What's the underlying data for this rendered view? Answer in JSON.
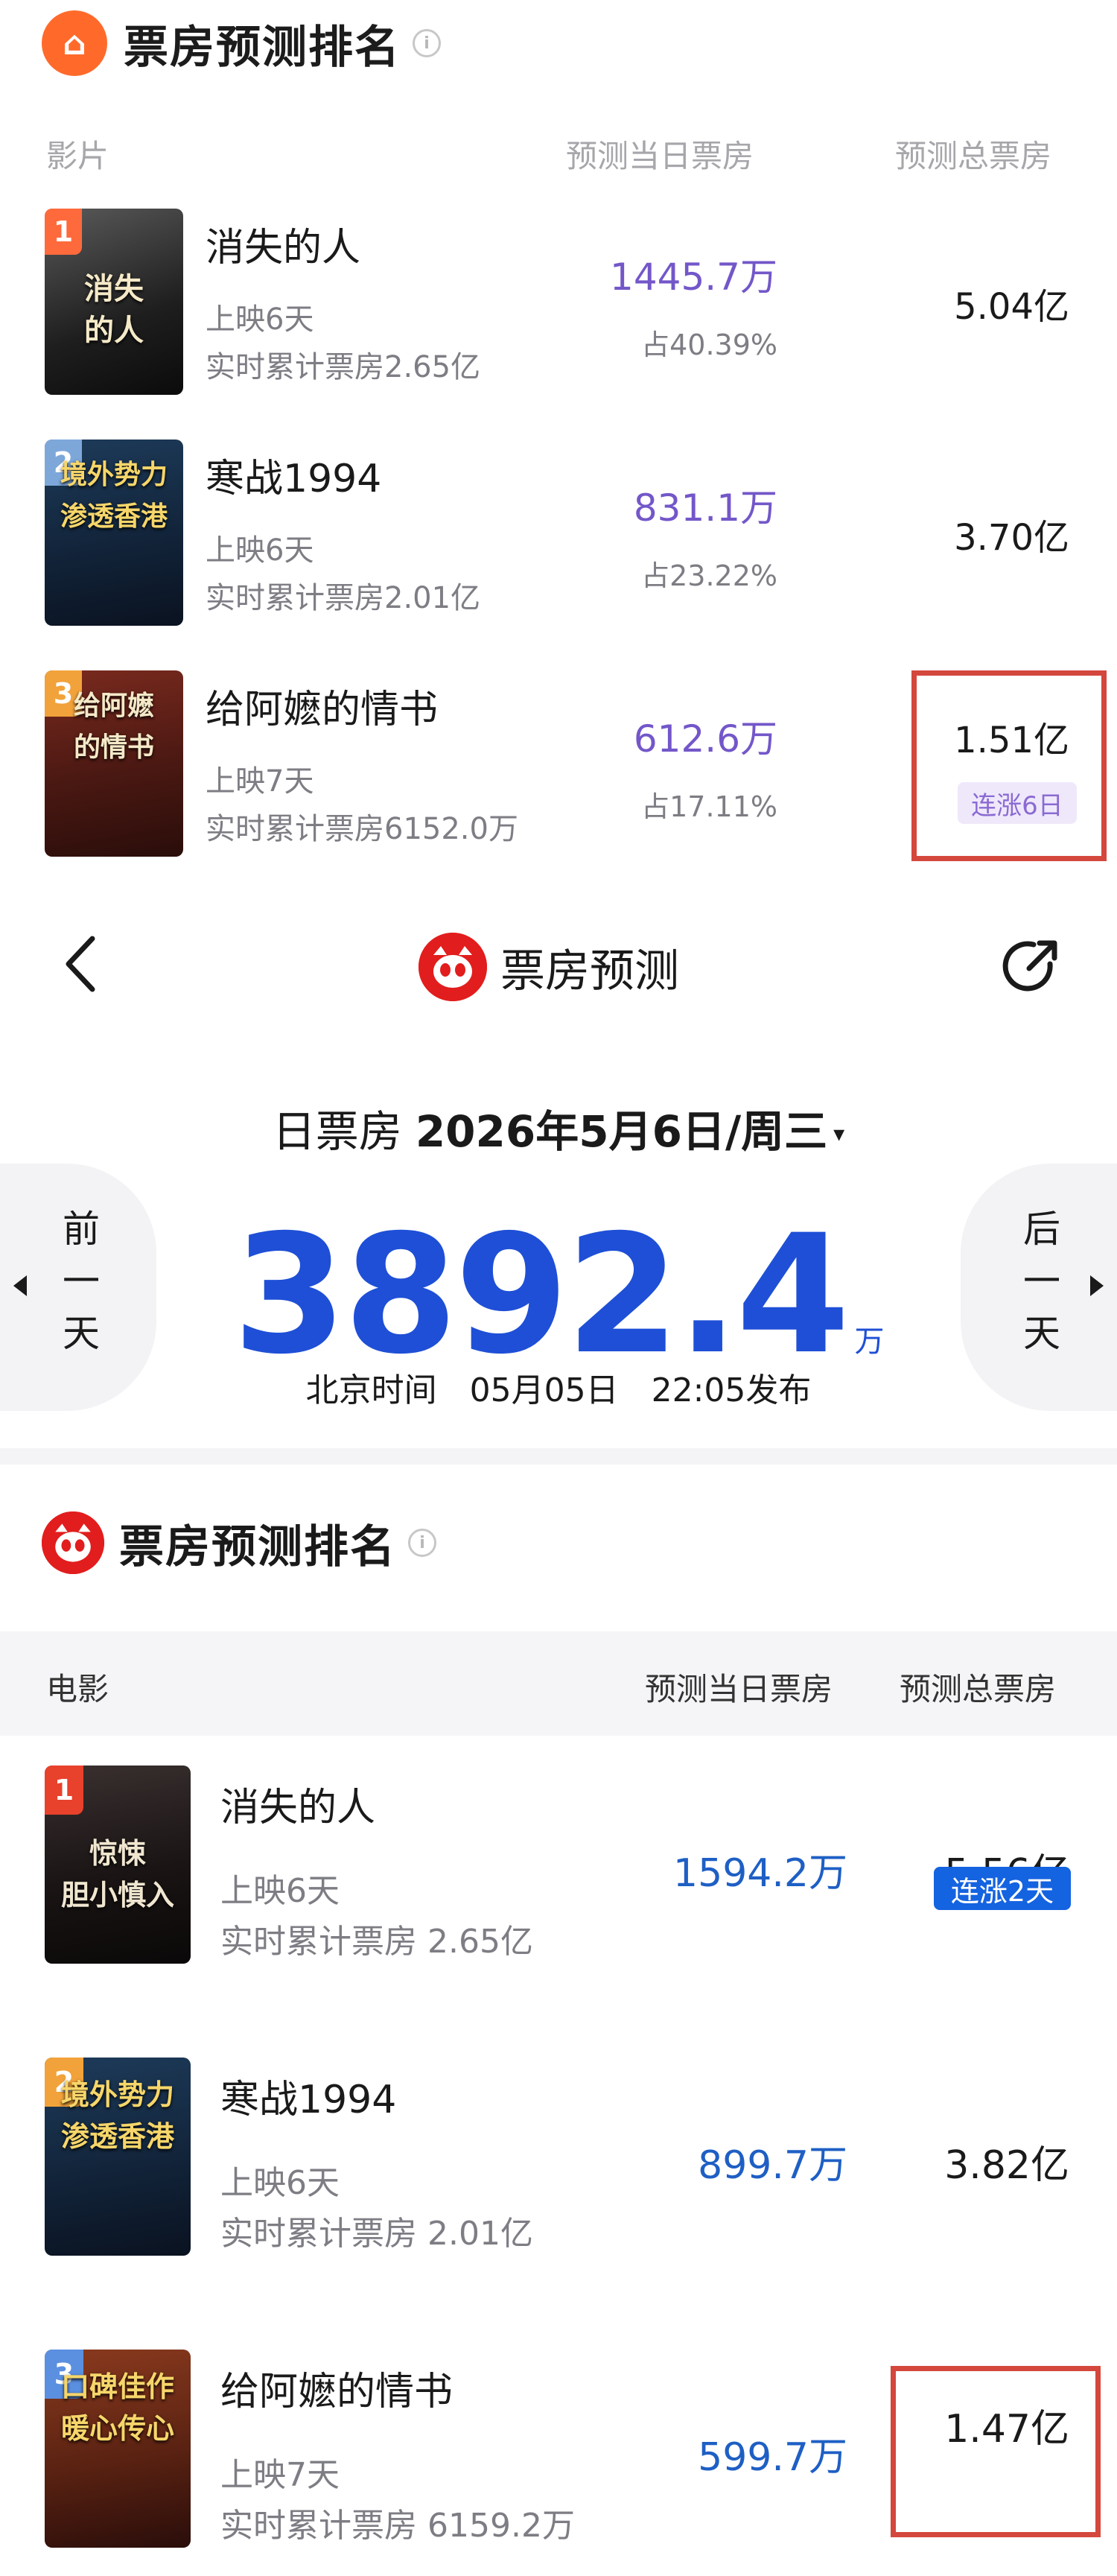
{
  "top_section": {
    "title": "票房预测排名",
    "logo_glyph": "⌂",
    "info_glyph": "i",
    "columns": {
      "film": "影片",
      "day": "预测当日票房",
      "total": "预测总票房"
    },
    "rows": [
      {
        "rank": "1",
        "rank_color": "#ff6a3d",
        "poster_text": "消失\n的人",
        "name": "消失的人",
        "days": "上映6天",
        "cumulative": "实时累计票房2.65亿",
        "day_box": "1445.7万",
        "share": "占40.39%",
        "total": "5.04亿"
      },
      {
        "rank": "2",
        "rank_color": "#7da7d9",
        "poster_text": "境外势力\n渗透香港",
        "name": "寒战1994",
        "days": "上映6天",
        "cumulative": "实时累计票房2.01亿",
        "day_box": "831.1万",
        "share": "占23.22%",
        "total": "3.70亿"
      },
      {
        "rank": "3",
        "rank_color": "#f2a23a",
        "poster_text": "给阿嬷\n的情书",
        "name": "给阿嬷的情书",
        "days": "上映7天",
        "cumulative": "实时累计票房6152.0万",
        "day_box": "612.6万",
        "share": "占17.11%",
        "total": "1.51亿",
        "badge": "连涨6日"
      }
    ]
  },
  "bottom_section": {
    "nav": {
      "title": "票房预测",
      "back_icon": "chevron-left-icon",
      "share_icon": "share-icon"
    },
    "date_label": "日票房",
    "date": "2026年5月6日/周三",
    "caret": "▾",
    "big_value": "3892.4",
    "big_unit": "万",
    "publish": "北京时间　05月05日　22:05发布",
    "prev_day": "前一天",
    "next_day": "后一天",
    "ranking_title": "票房预测排名",
    "columns": {
      "film": "电影",
      "day": "预测当日票房",
      "total": "预测总票房"
    },
    "rows": [
      {
        "rank": "1",
        "rank_color": "#e8412c",
        "poster_text": "惊悚\n胆小慎入",
        "name": "消失的人",
        "days": "上映6天",
        "cumulative": "实时累计票房 2.65亿",
        "day_box": "1594.2万",
        "total": "5.56亿"
      },
      {
        "rank": "2",
        "rank_color": "#f2a23a",
        "poster_text": "境外势力\n渗透香港",
        "name": "寒战1994",
        "days": "上映6天",
        "cumulative": "实时累计票房 2.01亿",
        "day_box": "899.7万",
        "total": "3.82亿"
      },
      {
        "rank": "3",
        "rank_color": "#5b8fe0",
        "poster_text": "口碑佳作\n暖心传心",
        "name": "给阿嬷的情书",
        "days": "上映7天",
        "cumulative": "实时累计票房 6159.2万",
        "day_box": "599.7万",
        "total": "1.47亿",
        "badge": "连涨2天"
      }
    ]
  },
  "colors": {
    "accent_purple": "#7357c9",
    "accent_blue": "#1e4fd6",
    "highlight_red": "#d4473c",
    "maoyan_red": "#e21d1d"
  }
}
